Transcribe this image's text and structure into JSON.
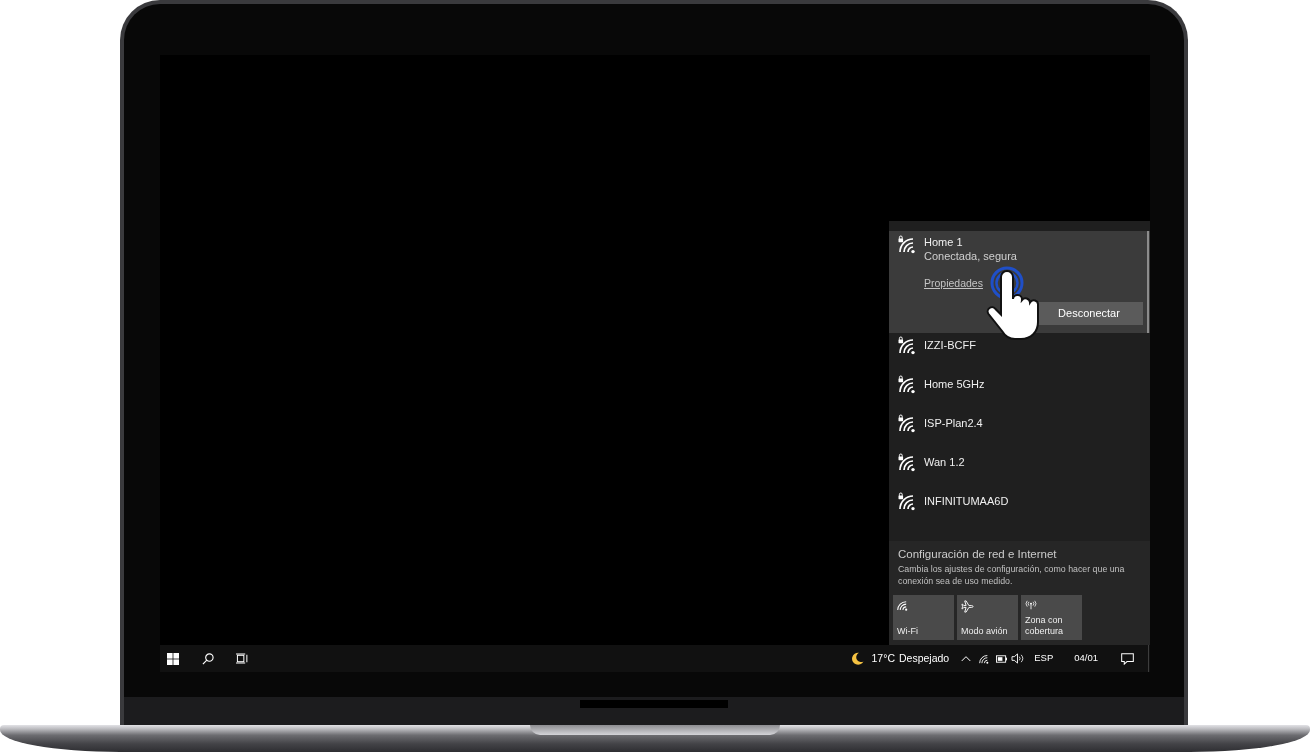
{
  "network_flyout": {
    "networks": [
      {
        "name": "Home 1",
        "selected": true,
        "status": "Conectada, segura",
        "link": "Propiedades",
        "action": "Desconectar"
      },
      {
        "name": "IZZI-BCFF",
        "selected": false
      },
      {
        "name": "Home 5GHz",
        "selected": false
      },
      {
        "name": "ISP-Plan2.4",
        "selected": false
      },
      {
        "name": "Wan 1.2",
        "selected": false
      },
      {
        "name": "INFINITUMAA6D",
        "selected": false
      }
    ],
    "settings_link": {
      "title": "Configuración de red e Internet",
      "description": "Cambia los ajustes de configuración, como hacer que una conexión sea de uso medido."
    },
    "quick_actions": [
      {
        "kind": "wifi",
        "label": "Wi-Fi",
        "on": false
      },
      {
        "kind": "airplane",
        "label": "Modo avión",
        "on": false
      },
      {
        "kind": "hotspot",
        "label": "Zona con cobertura",
        "on": false
      }
    ]
  },
  "taskbar": {
    "weather": {
      "temperature": "17°C",
      "condition": "Despejado"
    },
    "language": "ESP",
    "date": "04/01"
  }
}
